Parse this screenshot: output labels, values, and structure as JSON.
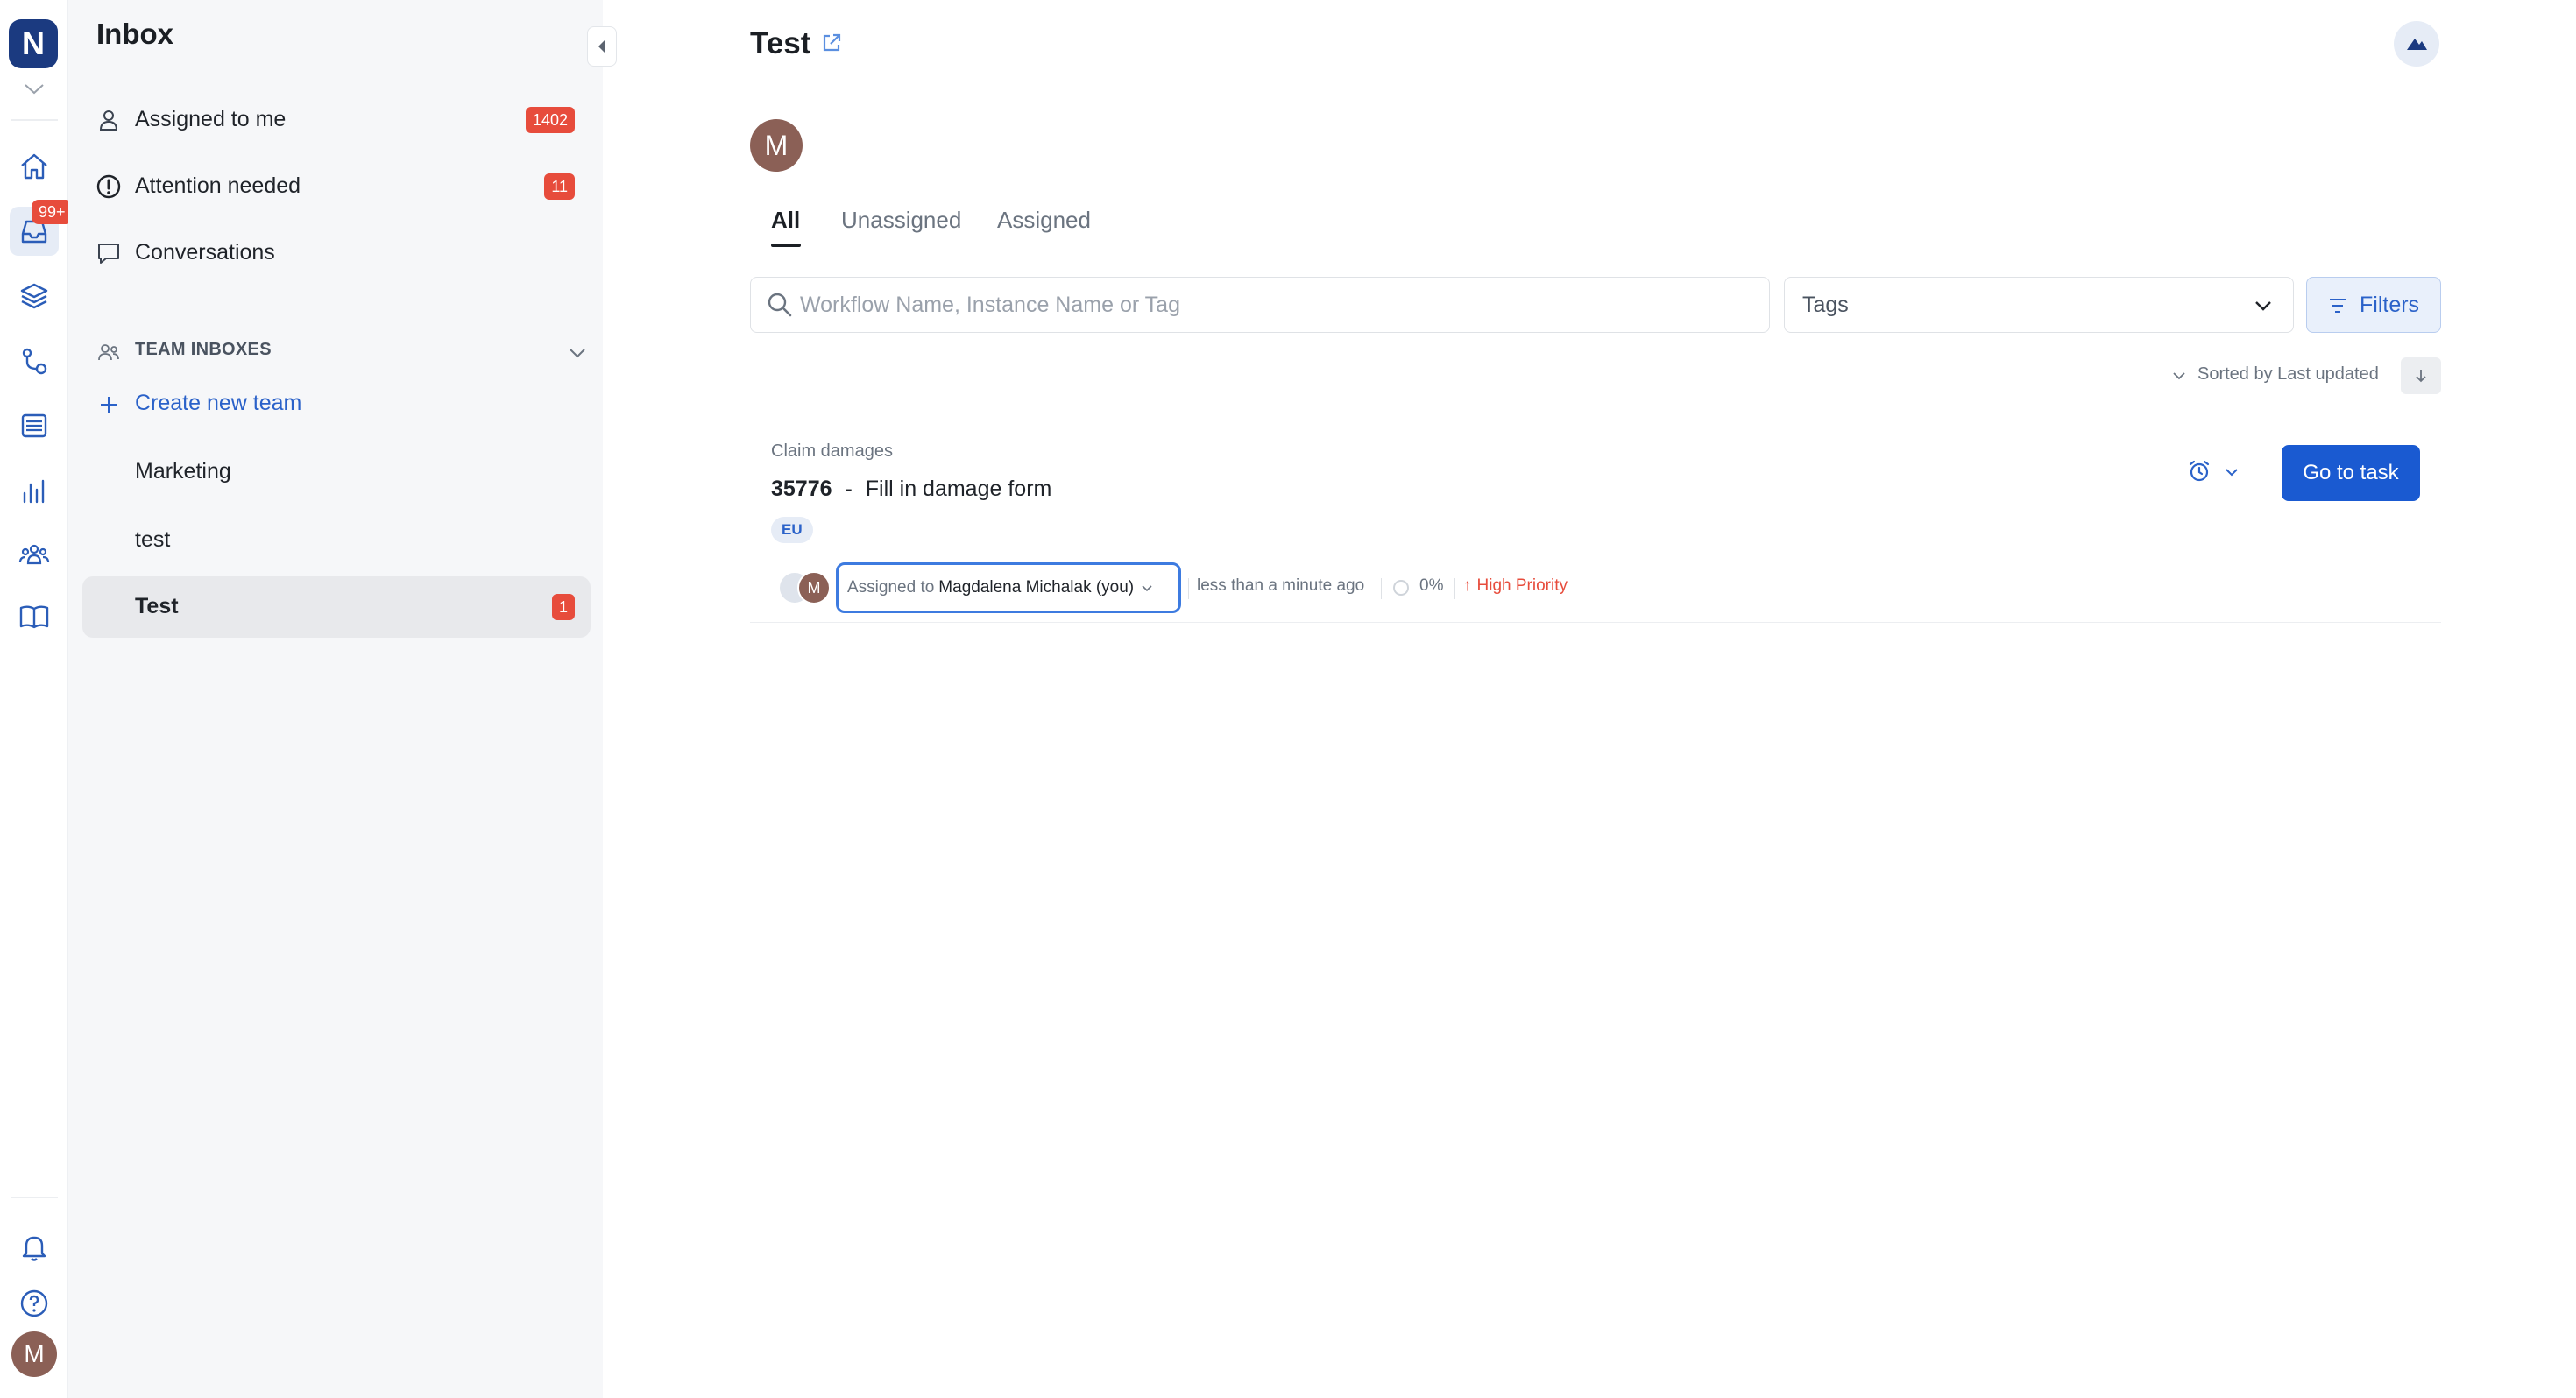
{
  "rail": {
    "logo_letter": "N",
    "inbox_badge": "99+",
    "avatar_initial": "M",
    "items": [
      "home-icon",
      "inbox-icon",
      "layers-icon",
      "workflow-icon",
      "list-icon",
      "analytics-icon",
      "team-icon",
      "book-icon"
    ],
    "bottom": [
      "bell-icon",
      "help-icon"
    ]
  },
  "sidebar": {
    "title": "Inbox",
    "items": [
      {
        "label": "Assigned to me",
        "count": "1402",
        "icon": "user-icon"
      },
      {
        "label": "Attention needed",
        "count": "11",
        "icon": "alert-icon"
      },
      {
        "label": "Conversations",
        "count": "",
        "icon": "chat-icon"
      }
    ],
    "team_section_label": "TEAM INBOXES",
    "create_team_label": "Create new team",
    "teams": [
      {
        "label": "Marketing",
        "count": ""
      },
      {
        "label": "test",
        "count": ""
      },
      {
        "label": "Test",
        "count": "1",
        "selected": true
      }
    ]
  },
  "main": {
    "title": "Test",
    "owner_initial": "M",
    "tabs": [
      "All",
      "Unassigned",
      "Assigned"
    ],
    "active_tab": "All",
    "search": {
      "placeholder": "Workflow Name, Instance Name or Tag"
    },
    "tags_select": {
      "value": "Tags"
    },
    "filters_label": "Filters",
    "sort_label": "Sorted by Last updated",
    "tasks": [
      {
        "workflow": "Claim damages",
        "number": "35776",
        "separator": "-",
        "name": "Fill in damage form",
        "tag": "EU",
        "assignee_prefix": "Assigned to",
        "assignee": "Magdalena Michalak (you)",
        "assignee_initial": "M",
        "updated": "less than a minute ago",
        "progress": "0%",
        "priority": "High Priority",
        "action_label": "Go to task"
      }
    ]
  },
  "colors": {
    "brand": "#1b3a80",
    "accent": "#2b62c9",
    "primary_button": "#1a5ad1",
    "badge": "#e74c3c",
    "priority_high": "#e74c3c",
    "avatar": "#8b6056"
  }
}
